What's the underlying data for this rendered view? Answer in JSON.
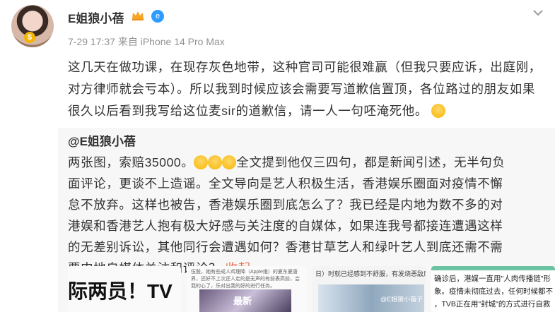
{
  "author": {
    "name": "E姐狼小蓓",
    "avatar_badge": "$",
    "verify_icon": "e"
  },
  "post": {
    "meta": "7-29 17:37  来自 iPhone 14 Pro Max",
    "text": "这几天在做功课，在现存灰色地带，这种官司可能很难赢（但我只要应诉，出庭刚，对方律师就会亏本）。所以我到时候应该会需要写道歉信置顶，各位路过的朋友如果很久以后看到我写给这位麦sir的道歉信，请一人一句呸淹死他。"
  },
  "repost": {
    "author": "@E姐狼小蓓",
    "text_before": "两张图，索赔35000。",
    "text_after": "全文提到他仅三四句，都是新闻引述，无半句负面评论，更谈不上造谣。全文导向是艺人积极生活，香港娱乐圈面对疫情不懈怠不放弃。这样也被告，香港娱乐圈到底怎么了？我已经是内地为数不多的对港娱和香港艺人抱有极大好感与关注度的自媒体，如果连我号都接连遭遇这样的无差别诉讼，其他同行会遭遇如何？香港甘草艺人和绿叶艺人到底还需不需要内地自媒体关注和评论？",
    "collapse": "收起"
  },
  "thumbnails": {
    "t1_text": "际两员！TV",
    "t2_caption": "伍殷，她有些成人鸡理降（Apple维）的夏东夏唐界，还好不上次还人走的是无声的有前表高前，会我的心了，乐对出我的好的进行任务。",
    "t2_pic_text": "最新",
    "t3_caption": "日）时就已经感到不舒服，有发烧恶敌后",
    "t3_watermark": "@E姐狼小蓓子",
    "t4_line1": "确诊后，港媒一直用\"人肉传播链\"形",
    "t4_line2": "象。疫情未彻底过去，任何时候都不",
    "t4_line3": "，TVB正在用\"封城\"的方式进行自救"
  },
  "colors": {
    "accent": "#eb7350",
    "repost_bg": "#f7f7f7",
    "meta": "#939393",
    "verify": "#2e9bff"
  }
}
